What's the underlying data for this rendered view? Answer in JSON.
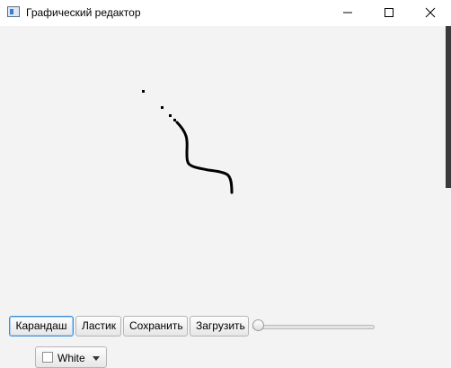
{
  "window": {
    "title": "Графический редактор",
    "icon": "app-window-icon",
    "controls": [
      "minimize-icon",
      "maximize-icon",
      "close-icon"
    ]
  },
  "toolbar": {
    "pencil_label": "Карандаш",
    "eraser_label": "Ластик",
    "save_label": "Сохранить",
    "load_label": "Загрузить",
    "active_tool": "pencil",
    "brush_size_fraction": 0.0
  },
  "color_picker": {
    "selected_label": "White",
    "selected_color": "#ffffff"
  },
  "canvas": {
    "background": "#f3f3f3",
    "stroke_color": "#000000"
  }
}
